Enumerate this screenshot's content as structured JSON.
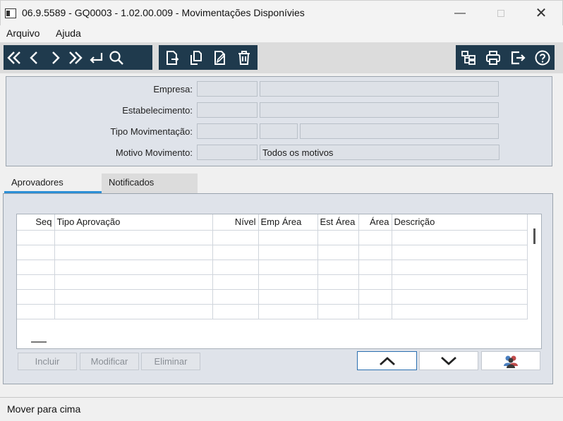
{
  "window": {
    "title": "06.9.5589 - GQ0003 - 1.02.00.009 - Movimentações Disponívies",
    "minimize_glyph": "—",
    "close_glyph": "✕"
  },
  "menu": {
    "file": "Arquivo",
    "help": "Ajuda"
  },
  "toolbar": {
    "left_icons": [
      "first-icon",
      "previous-icon",
      "next-icon",
      "last-icon",
      "return-icon",
      "search-icon"
    ],
    "edit_icons": [
      "new-document-icon",
      "copy-document-icon",
      "edit-document-icon",
      "delete-icon"
    ],
    "right_icons": [
      "hierarchy-icon",
      "print-icon",
      "exit-icon",
      "help-icon"
    ],
    "background_color": "#1f3a4d"
  },
  "form": {
    "empresa_label": "Empresa:",
    "estabelecimento_label": "Estabelecimento:",
    "tipo_movimentacao_label": "Tipo Movimentação:",
    "motivo_movimento_label": "Motivo Movimento:",
    "motivo_movimento_value": "Todos os motivos"
  },
  "tabs": {
    "aprovadores": "Aprovadores",
    "notificados": "Notificados",
    "accent_color": "#2c8fd6"
  },
  "grid": {
    "columns": [
      "Seq",
      "Tipo Aprovação",
      "Nível",
      "Emp Área",
      "Est Área",
      "Área",
      "Descrição"
    ],
    "empty_rows": 6
  },
  "buttons": {
    "incluir": "Incluir",
    "modificar": "Modificar",
    "eliminar": "Eliminar",
    "move_up_icon": "chevron-up-icon",
    "move_down_icon": "chevron-down-icon",
    "users_icon": "users-icon"
  },
  "status": {
    "text": "Mover para cima"
  }
}
